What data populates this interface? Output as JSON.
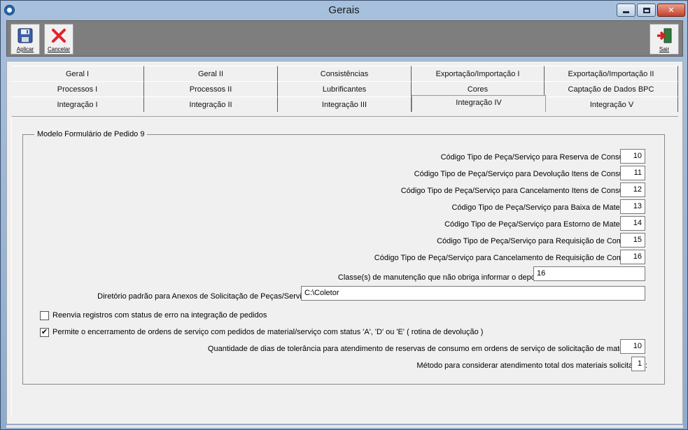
{
  "window": {
    "title": "Gerais"
  },
  "toolbar": {
    "aplicar": "Aplicar",
    "cancelar": "Cancelar",
    "sair": "Sair"
  },
  "tabs": {
    "row1": [
      "Geral I",
      "Geral II",
      "Consistências",
      "Exportação/Importação I",
      "Exportação/Importação II"
    ],
    "row2": [
      "Processos I",
      "Processos II",
      "Lubrificantes",
      "Cores",
      "Captação de Dados BPC"
    ],
    "row3": [
      "Integração I",
      "Integração II",
      "Integração III",
      "Integração IV",
      "Integração V"
    ],
    "active": "Integração IV"
  },
  "group": {
    "legend": "Modelo Formulário de Pedido 9",
    "fields": [
      {
        "label": "Código Tipo de Peça/Serviço para Reserva de Consumo:",
        "value": "10"
      },
      {
        "label": "Código Tipo de Peça/Serviço para Devolução Itens de Consumo:",
        "value": "11"
      },
      {
        "label": "Código Tipo de Peça/Serviço para Cancelamento Itens de Consumo:",
        "value": "12"
      },
      {
        "label": "Código Tipo de Peça/Serviço para Baixa de Materiais:",
        "value": "13"
      },
      {
        "label": "Código Tipo de Peça/Serviço para Estorno de Materiais:",
        "value": "14"
      },
      {
        "label": "Código Tipo de Peça/Serviço para Requisição de Compra:",
        "value": "15"
      },
      {
        "label": "Código Tipo de Peça/Serviço para Cancelamento de Requisição de Compra:",
        "value": "16"
      }
    ],
    "classes": {
      "label": "Classe(s) de manutenção que não obriga informar o deposito:",
      "value": "16"
    },
    "diretorio": {
      "label": "Diretório padrão para Anexos de Solicitação de Peças/Serviços:",
      "value": "C:\\Coletor"
    },
    "chk_reenvia": {
      "label": "Reenvia registros com status de erro na integração de pedidos",
      "checked": false
    },
    "chk_permite": {
      "label": "Permite o encerramento de ordens de serviço com pedidos de material/serviço com status 'A', 'D' ou 'E' ( rotina de devolução )",
      "checked": true
    },
    "dias": {
      "label": "Quantidade de dias de tolerância para atendimento de reservas de consumo em ordens de serviço de solicitação de material:",
      "value": "10"
    },
    "metodo": {
      "label": "Método para considerar atendimento total dos materiais solicitados:",
      "value": "1"
    }
  }
}
